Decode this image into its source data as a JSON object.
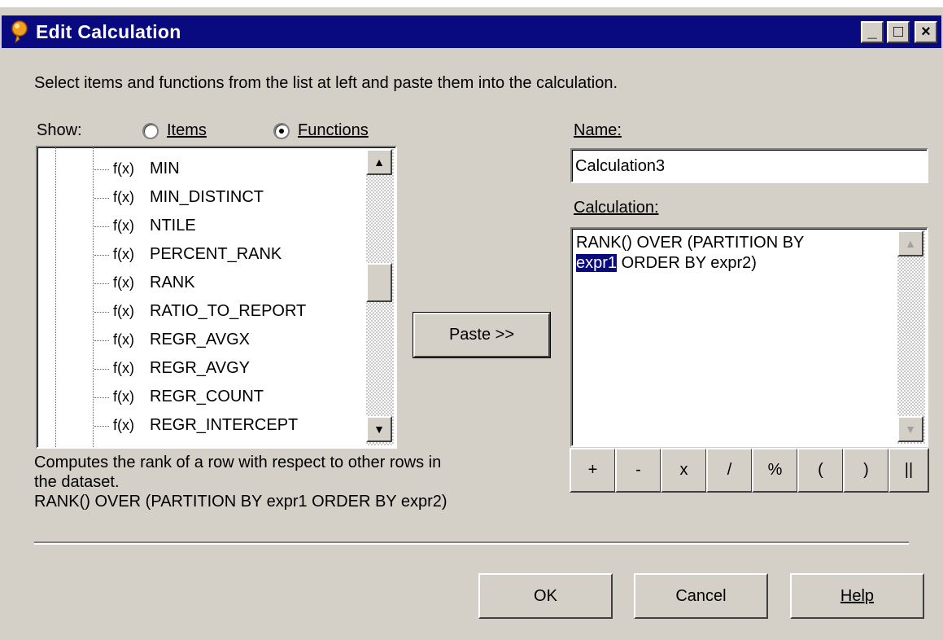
{
  "window": {
    "title": "Edit Calculation",
    "controls": {
      "minimize": "_",
      "maximize": "□",
      "close": "×"
    }
  },
  "instructions": "Select items and functions from the list at left and paste them into the calculation.",
  "show": {
    "label": "Show:",
    "options": [
      {
        "label": "Items",
        "selected": false
      },
      {
        "label": "Functions",
        "selected": true
      }
    ]
  },
  "function_list": {
    "prefix": "f(x)",
    "items": [
      "MIN",
      "MIN_DISTINCT",
      "NTILE",
      "PERCENT_RANK",
      "RANK",
      "RATIO_TO_REPORT",
      "REGR_AVGX",
      "REGR_AVGY",
      "REGR_COUNT",
      "REGR_INTERCEPT"
    ],
    "selected": "RANK"
  },
  "description": {
    "line1": "Computes the rank of a row with respect to other rows in",
    "line2": "the dataset.",
    "line3": "RANK() OVER (PARTITION BY expr1 ORDER BY expr2)"
  },
  "paste_button": "Paste >>",
  "name": {
    "label": "Name:",
    "value": "Calculation3"
  },
  "calculation": {
    "label": "Calculation:",
    "line1": "RANK() OVER (PARTITION BY",
    "highlighted": "expr1",
    "line2_rest": " ORDER BY expr2)"
  },
  "operators": [
    "+",
    "-",
    "x",
    "/",
    "%",
    "(",
    ")",
    "||"
  ],
  "buttons": {
    "ok": "OK",
    "cancel": "Cancel",
    "help": "Help"
  },
  "colors": {
    "titlebar": "#0a0a80",
    "face": "#d4d0c8",
    "highlight": "#0a0a80"
  }
}
